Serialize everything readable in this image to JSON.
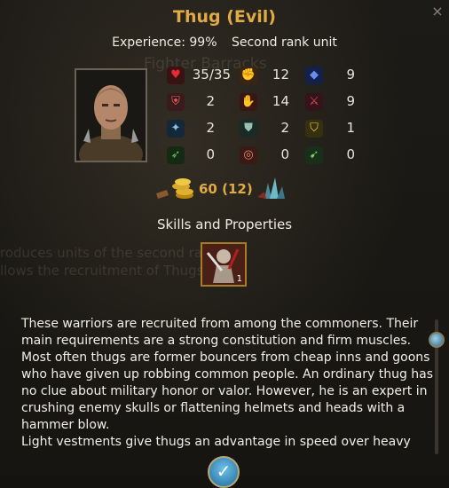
{
  "window": {
    "title": "Thug (Evil)",
    "close_glyph": "×"
  },
  "background_ghost": {
    "building_title": "Fighter Barracks",
    "line1": "roduces units of the second rank.",
    "line2": "llows the recruitment of Thugs."
  },
  "unit": {
    "experience_label": "Experience: 99%",
    "rank_label": "Second rank unit",
    "portrait_icon": "thug-portrait"
  },
  "stats": [
    [
      {
        "icon": "heart-icon",
        "color": "#d0212b",
        "value": "35/35"
      },
      {
        "icon": "fist-icon",
        "color": "#d86a2a",
        "value": "12"
      },
      {
        "icon": "blue-book-icon",
        "color": "#2a55c8",
        "value": "9"
      }
    ],
    [
      {
        "icon": "shield-strike-icon",
        "color": "#c84040",
        "value": "2"
      },
      {
        "icon": "red-gauntlet-icon",
        "color": "#c8402a",
        "value": "14"
      },
      {
        "icon": "crossed-swords-icon",
        "color": "#a53838",
        "value": "9"
      }
    ],
    [
      {
        "icon": "ice-axe-icon",
        "color": "#5a9abf",
        "value": "2"
      },
      {
        "icon": "spear-shield-icon",
        "color": "#7a9a8a",
        "value": "2"
      },
      {
        "icon": "gold-shield-icon",
        "color": "#d0b040",
        "value": "1"
      }
    ],
    [
      {
        "icon": "green-bow-icon",
        "color": "#3f8a3a",
        "value": "0"
      },
      {
        "icon": "target-icon",
        "color": "#b84a3a",
        "value": "0"
      },
      {
        "icon": "green-arrows-icon",
        "color": "#4f9f35",
        "value": "0"
      }
    ]
  ],
  "cost": {
    "gold_icon": "gold-coins-icon",
    "crystal_icon": "crystal-icon",
    "value": "60 (12)"
  },
  "skills": {
    "title": "Skills and Properties",
    "items": [
      {
        "icon": "warrior-skill-icon",
        "badge": "1"
      }
    ]
  },
  "description": {
    "paragraph1": "These warriors are recruited from among the commoners. Their main requirements are a strong constitution and firm muscles. Most often thugs are former bouncers from cheap inns and goons who have given up robbing common people. An ordinary thug has no clue about military honor or valor. However, he is an expert in crushing enemy skulls or flattening helmets and heads with a hammer blow.",
    "paragraph2": "Light vestments give thugs an advantage in speed over heavy"
  },
  "confirm": {
    "glyph": "✓"
  }
}
